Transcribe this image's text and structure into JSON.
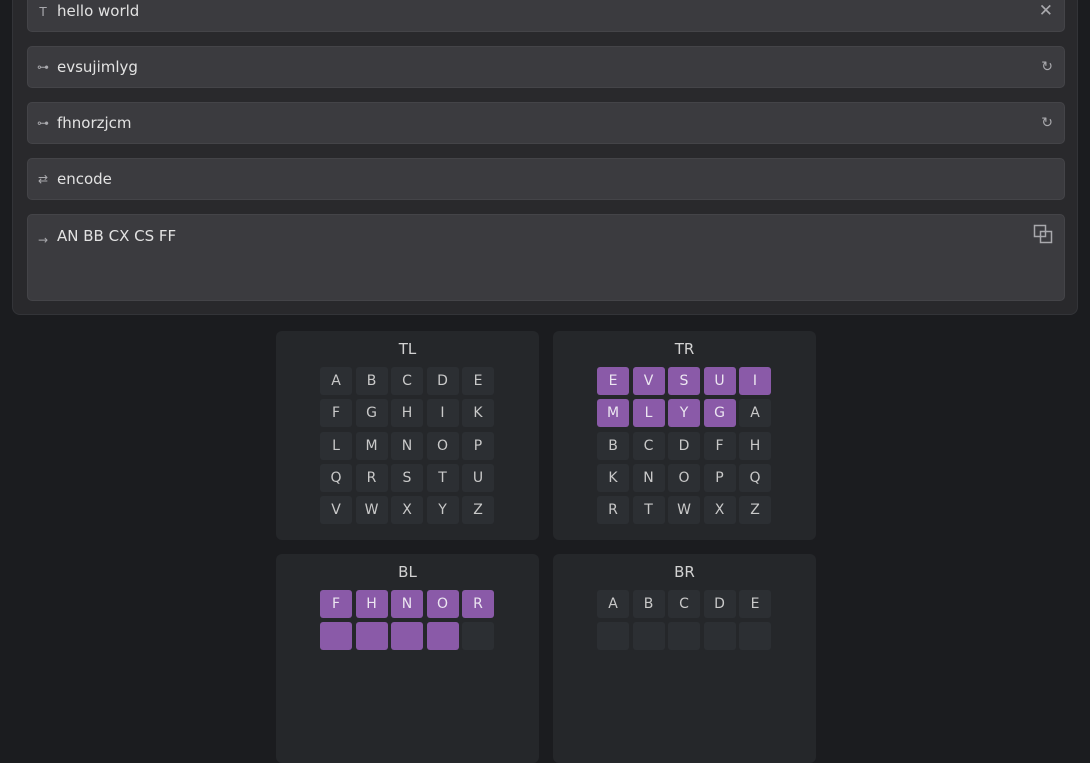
{
  "inputs": {
    "plaintext": {
      "icon": "text-icon",
      "value": "hello world",
      "action_icon": "clear-icon"
    },
    "key1": {
      "icon": "key-icon",
      "value": "evsujimlyg",
      "action_icon": "regenerate-icon"
    },
    "key2": {
      "icon": "key-icon",
      "value": "fhnorzjcm",
      "action_icon": "regenerate-icon"
    },
    "mode": {
      "icon": "swap-icon",
      "value": "encode"
    },
    "output": {
      "icon": "arrow-right-icon",
      "value": "AN BB CX CS FF",
      "action_icon": "copy-icon"
    }
  },
  "squares": [
    {
      "title": "TL",
      "letters": [
        "A",
        "B",
        "C",
        "D",
        "E",
        "F",
        "G",
        "H",
        "I",
        "K",
        "L",
        "M",
        "N",
        "O",
        "P",
        "Q",
        "R",
        "S",
        "T",
        "U",
        "V",
        "W",
        "X",
        "Y",
        "Z"
      ],
      "highlighted": 0
    },
    {
      "title": "TR",
      "letters": [
        "E",
        "V",
        "S",
        "U",
        "I",
        "M",
        "L",
        "Y",
        "G",
        "A",
        "B",
        "C",
        "D",
        "F",
        "H",
        "K",
        "N",
        "O",
        "P",
        "Q",
        "R",
        "T",
        "W",
        "X",
        "Z"
      ],
      "highlighted": 9
    },
    {
      "title": "BL",
      "letters": [
        "F",
        "H",
        "N",
        "O",
        "R"
      ],
      "highlighted": 5
    },
    {
      "title": "BR",
      "letters": [
        "A",
        "B",
        "C",
        "D",
        "E"
      ],
      "highlighted": 0
    }
  ],
  "colors": {
    "highlight": "#8a5aa8",
    "cell": "#2c2f33",
    "panel": "#25272a"
  }
}
